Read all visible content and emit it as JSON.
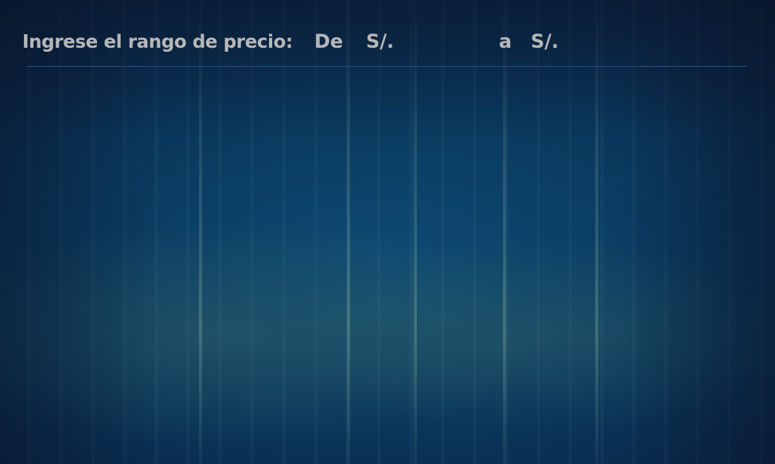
{
  "price_filter": {
    "label": "Ingrese el rango de precio:",
    "from_word": "De",
    "from_currency": "S/.",
    "from_value": "",
    "to_word": "a",
    "to_currency": "S/.",
    "to_value": ""
  },
  "colors": {
    "text": "#b7b7b7",
    "divider": "#1f4f86",
    "background": "#0a3559"
  }
}
